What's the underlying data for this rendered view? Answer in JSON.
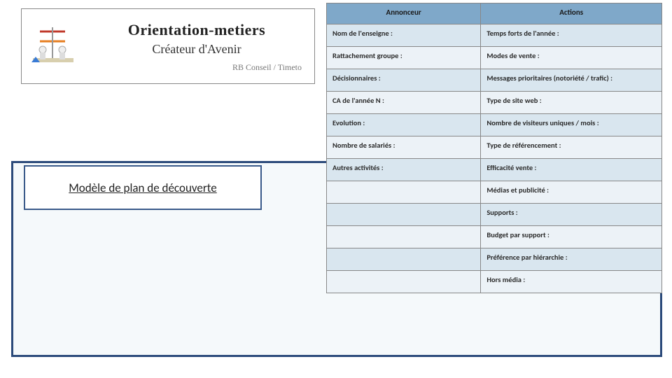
{
  "logo": {
    "title": "Orientation-metiers",
    "subtitle": "Créateur d'Avenir",
    "footer": "RB Conseil / Timeto"
  },
  "title_box": "Modèle de plan de découverte",
  "table": {
    "headers": {
      "col1": "Annonceur",
      "col2": "Actions"
    },
    "rows": [
      {
        "c1": "Nom de l'enseigne :",
        "c2": "Temps forts de l'année :"
      },
      {
        "c1": "Rattachement groupe :",
        "c2": "Modes de vente :"
      },
      {
        "c1": "Décisionnaires :",
        "c2": "Messages prioritaires (notoriété / trafic) :"
      },
      {
        "c1": "CA de l'année N :",
        "c2": "Type de site web :"
      },
      {
        "c1": "Evolution :",
        "c2": "Nombre de visiteurs uniques / mois :"
      },
      {
        "c1": "Nombre de salariés :",
        "c2": "Type de référencement :"
      },
      {
        "c1": "Autres activités :",
        "c2": "Efficacité vente :"
      }
    ],
    "tail": [
      "Médias et publicité :",
      "Supports :",
      "Budget par support :",
      "Préférence par hiérarchie :",
      "Hors média :"
    ]
  }
}
